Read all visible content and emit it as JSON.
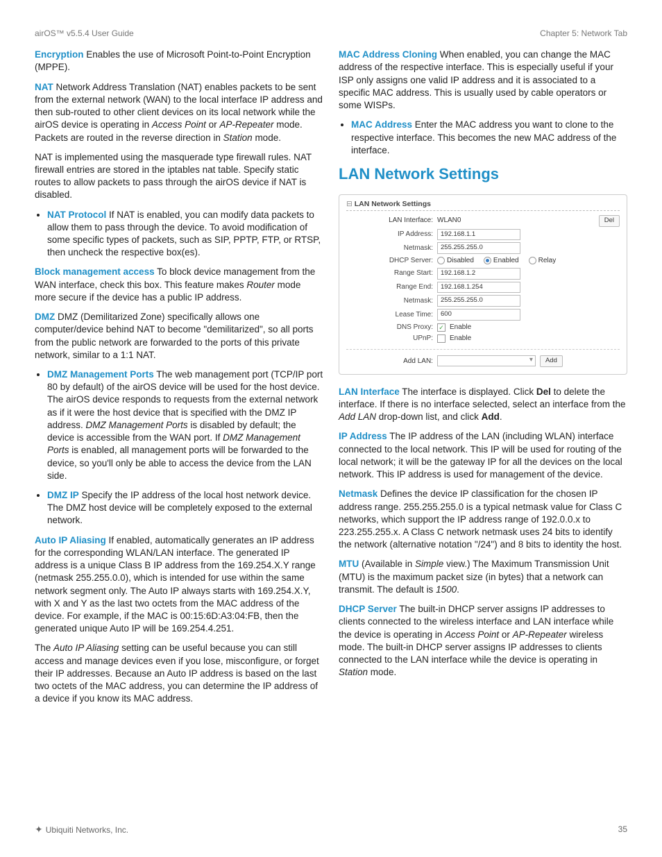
{
  "header": {
    "left": "airOS™ v5.5.4 User Guide",
    "right": "Chapter 5: Network Tab"
  },
  "left": {
    "encryption_label": "Encryption",
    "encryption_text": "  Enables the use of Microsoft Point-to-Point Encryption (MPPE).",
    "nat_label": "NAT",
    "nat_text_1": "  Network Address Translation (NAT) enables packets to be sent from the external network (WAN) to the local interface IP address and then sub-routed to other client devices on its local network while the airOS device is operating in ",
    "nat_text_1b": " or ",
    "nat_text_1c": " mode. Packets are routed in the reverse direction in ",
    "nat_text_1d": " mode.",
    "nat_em_ap": "Access Point",
    "nat_em_apr": "AP-Repeater",
    "nat_em_sta": "Station",
    "nat_text_2": "NAT is implemented using the masquerade type firewall rules. NAT firewall entries are stored in the iptables nat table. Specify static routes to allow packets to pass through the airOS device if NAT is disabled.",
    "nat_protocol_label": "NAT Protocol",
    "nat_protocol_text": "  If NAT is enabled, you can modify data packets to allow them to pass through the device. To avoid modification of some specific types of packets, such as SIP, PPTP, FTP, or RTSP, then uncheck the respective box(es).",
    "bma_label": "Block management access",
    "bma_text_a": "  To block device management from the WAN interface, check this box. This feature makes ",
    "bma_em": "Router",
    "bma_text_b": " mode more secure if the device has a public IP address.",
    "dmz_label": "DMZ",
    "dmz_text": "  DMZ (Demilitarized Zone) specifically allows one computer/device behind NAT to become \"demilitarized\", so all ports from the public network are forwarded to the ports of this private network, similar to a 1:1 NAT.",
    "dmz_mgmt_label": "DMZ Management Ports",
    "dmz_mgmt_text_a": "  The web management port (TCP/IP port 80 by default) of the airOS device will be used for the host device. The airOS device responds to requests from the external network as if it were the host device that is specified with the DMZ IP address. ",
    "dmz_mgmt_em": "DMZ Management Ports",
    "dmz_mgmt_text_b": " is disabled by default; the device is accessible from the WAN port. If ",
    "dmz_mgmt_em2": "DMZ Management Ports",
    "dmz_mgmt_text_c": " is enabled, all management ports will be forwarded to the device, so you'll only be able to access the device from the LAN side.",
    "dmz_ip_label": "DMZ IP",
    "dmz_ip_text": "  Specify the IP address of the local host network device. The DMZ host device will be completely exposed to the external network.",
    "aia_label": "Auto IP Aliasing",
    "aia_text_1": "  If enabled, automatically generates an IP address for the corresponding WLAN/LAN interface. The generated IP address is a unique Class B IP address from the 169.254.X.Y range (netmask 255.255.0.0), which is intended for use within the same network segment only. The Auto IP always starts with 169.254.X.Y, with X and Y as the last two octets from the MAC address of the device. For example, if the MAC is 00:15:6D:A3:04:FB, then the generated unique Auto IP will be 169.254.4.251.",
    "aia_text_2a": "The ",
    "aia_em": "Auto IP Aliasing",
    "aia_text_2b": " setting can be useful because you can still access and manage devices even if you lose, misconfigure, or forget their IP addresses. Because an Auto IP address is based on the last two octets of the MAC address, you can determine the IP address of a device if you know its MAC address."
  },
  "right": {
    "mac_clone_label": "MAC Address Cloning",
    "mac_clone_text": "  When enabled, you can change the MAC address of the respective interface. This is especially useful if your ISP only assigns one valid IP address and it is associated to a specific MAC address. This is usually used by cable operators or some WISPs.",
    "mac_addr_label": "MAC Address",
    "mac_addr_text": "  Enter the MAC address you want to clone to the respective interface. This becomes the new MAC address of the interface.",
    "section_title": "LAN Network Settings",
    "screenshot": {
      "title": "LAN Network Settings",
      "lan_if_label": "LAN Interface:",
      "lan_if_value": "WLAN0",
      "del": "Del",
      "ip_label": "IP Address:",
      "ip_val": "192.168.1.1",
      "nm_label": "Netmask:",
      "nm_val": "255.255.255.0",
      "dhcp_label": "DHCP Server:",
      "dhcp_disabled": "Disabled",
      "dhcp_enabled": "Enabled",
      "dhcp_relay": "Relay",
      "rs_label": "Range Start:",
      "rs_val": "192.168.1.2",
      "re_label": "Range End:",
      "re_val": "192.168.1.254",
      "nm2_label": "Netmask:",
      "nm2_val": "255.255.255.0",
      "lt_label": "Lease Time:",
      "lt_val": "600",
      "dns_label": "DNS Proxy:",
      "dns_chk": "Enable",
      "upnp_label": "UPnP:",
      "upnp_chk": "Enable",
      "addlan_label": "Add LAN:",
      "add": "Add"
    },
    "lan_if_label": "LAN Interface",
    "lan_if_text_a": "  The interface is displayed. Click ",
    "lan_if_del": "Del",
    "lan_if_text_b": " to delete the interface. If there is no interface selected, select an interface from the ",
    "lan_if_em": "Add LAN",
    "lan_if_text_c": " drop-down list, and click ",
    "lan_if_add": "Add",
    "lan_if_text_d": ".",
    "ip_label": "IP Address",
    "ip_text": "  The IP address of the LAN (including WLAN) interface connected to the local network. This IP will be used for routing of the local network; it will be the gateway IP for all the devices on the local network. This IP address is used for management of the device.",
    "nm_label": "Netmask",
    "nm_text": "  Defines the device IP classification for the chosen IP address range. 255.255.255.0 is a typical netmask value for Class C networks, which support the IP address range of 192.0.0.x to 223.255.255.x. A Class C network netmask uses 24 bits to identify the network (alternative notation \"/24\") and 8 bits to identity the host.",
    "mtu_label": "MTU",
    "mtu_text_a": "  (Available in ",
    "mtu_em": "Simple",
    "mtu_text_b": " view.) The Maximum Transmission Unit (MTU) is the maximum packet size (in bytes) that a network can transmit. The default is ",
    "mtu_em2": "1500",
    "mtu_text_c": ".",
    "dhcp_label": "DHCP Server",
    "dhcp_text_a": "  The built-in DHCP server assigns IP addresses to clients connected to the wireless interface and LAN interface while the device is operating in ",
    "dhcp_em_ap": "Access Point",
    "dhcp_text_b": " or ",
    "dhcp_em_apr": "AP-Repeater",
    "dhcp_text_c": " wireless mode. The built-in DHCP server assigns IP addresses to clients connected to the LAN interface while the device is operating in ",
    "dhcp_em_sta": "Station",
    "dhcp_text_d": " mode."
  },
  "footer": {
    "company": "Ubiquiti Networks, Inc.",
    "page": "35"
  }
}
